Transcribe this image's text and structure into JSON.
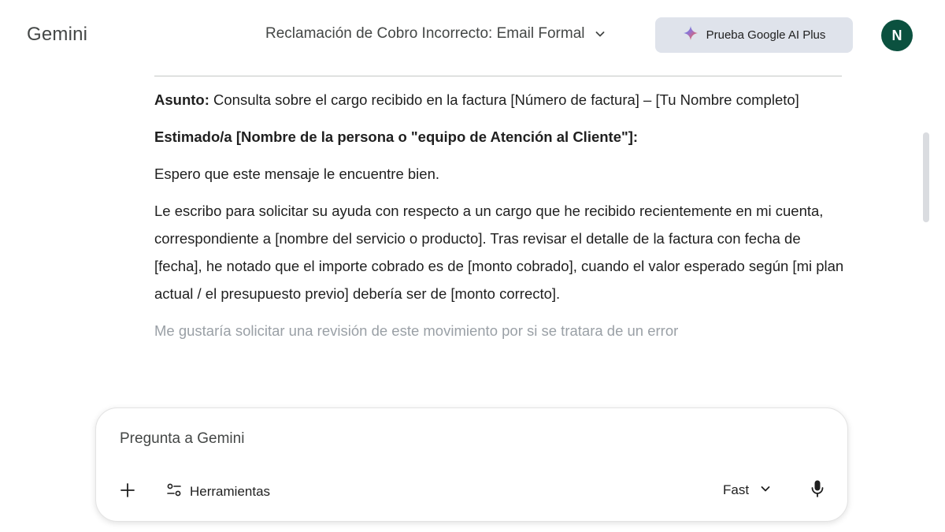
{
  "app": {
    "title": "Gemini"
  },
  "header": {
    "chat_title": "Reclamación de Cobro Incorrecto: Email Formal",
    "upgrade_label": "Prueba Google AI Plus",
    "avatar_initial": "N",
    "avatar_color": "#0b513f"
  },
  "message": {
    "subject_label": "Asunto:",
    "subject_text": " Consulta sobre el cargo recibido en la factura [Número de factura] – [Tu Nombre completo]",
    "greeting": "Estimado/a [Nombre de la persona o \"equipo de Atención al Cliente\"]:",
    "para1": "Espero que este mensaje le encuentre bien.",
    "para2": "Le escribo para solicitar su ayuda con respecto a un cargo que he recibido recientemente en mi cuenta, correspondiente a [nombre del servicio o producto]. Tras revisar el detalle de la factura con fecha de [fecha], he notado que el importe cobrado es de [monto cobrado], cuando el valor esperado según [mi plan actual / el presupuesto previo] debería ser de [monto correcto].",
    "para3": "Me gustaría solicitar una revisión de este movimiento por si se tratara de un error"
  },
  "input": {
    "placeholder": "Pregunta a Gemini",
    "tools_label": "Herramientas",
    "model_label": "Fast"
  },
  "icons": {
    "title_chevron": "chevron-down-icon",
    "sparkle": "gemini-sparkle-icon",
    "plus": "plus-icon",
    "tools": "tools-sliders-icon",
    "model_chevron": "chevron-down-icon",
    "mic": "microphone-icon"
  }
}
